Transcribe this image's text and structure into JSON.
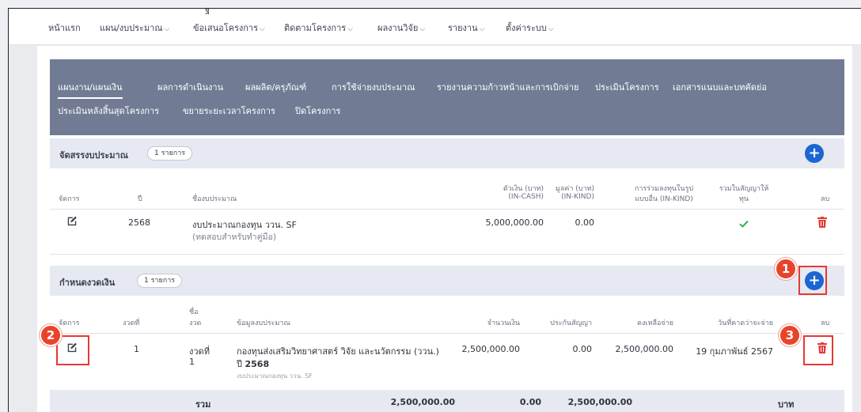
{
  "topnav": {
    "cut_glyph": "ฐ",
    "items": [
      {
        "label": "หน้าแรก",
        "has_chevron": false
      },
      {
        "label": "แผน/งบประมาณ",
        "has_chevron": true
      },
      {
        "label": "ข้อเสนอโครงการ",
        "has_chevron": true
      },
      {
        "label": "ติดตามโครงการ",
        "has_chevron": true
      },
      {
        "label": "ผลงานวิจัย",
        "has_chevron": true
      },
      {
        "label": "รายงาน",
        "has_chevron": true
      },
      {
        "label": "ตั้งค่าระบบ",
        "has_chevron": true
      }
    ],
    "chevron": "⌵"
  },
  "tabs": [
    "แผนงาน/แผนเงิน",
    "ผลการดำเนินงาน",
    "ผลผลิต/ครุภัณฑ์",
    "การใช้จ่ายงบประมาณ",
    "รายงานความก้าวหน้าและการเบิกจ่าย",
    "ประเมินโครงการ",
    "เอกสารแนบและบทคัดย่อ",
    "ประเมินหลังสิ้นสุดโครงการ",
    "ขยายระยะเวลาโครงการ",
    "ปิดโครงการ"
  ],
  "budget": {
    "title": "จัดสรรงบประมาณ",
    "count": "1 รายการ",
    "headers": {
      "manage": "จัดการ",
      "year": "ปี",
      "name": "ชื่องบประมาณ",
      "cash_1": "ตัวเงิน (บาท)",
      "cash_2": "(IN-CASH)",
      "kind_1": "มูลค่า (บาท)",
      "kind_2": "(IN-KIND)",
      "other_1": "การร่วมลงทุนในรูป",
      "other_2": "แบบอื่น (IN-KIND)",
      "contract_1": "รวมในสัญญาให้",
      "contract_2": "ทุน",
      "delete": "ลบ"
    },
    "row": {
      "year": "2568",
      "name": "งบประมาณกองทุน ววน. SF",
      "note": "(ทดสอบสำหรับทำคู่มือ)",
      "cash": "5,000,000.00",
      "kind": "0.00",
      "in_contract": true
    }
  },
  "installments": {
    "title": "กำหนดงวดเงิน",
    "count": "1 รายการ",
    "headers": {
      "manage": "จัดการ",
      "no": "งวดที่",
      "inst_name_1": "ชื่อ",
      "inst_name_2": "งวด",
      "budget_info": "ข้อมูลงบประมาณ",
      "amount": "จำนวนเงิน",
      "guarantee": "ประกันสัญญา",
      "remaining": "คงเหลือจ่าย",
      "due_date": "วันที่คาดว่าจะจ่าย",
      "delete": "ลบ"
    },
    "row": {
      "no": "1",
      "name_1": "งวดที่",
      "name_2": "1",
      "fund": "กองทุนส่งเสริมวิทยาศาสตร์ วิจัย และนวัตกรรม (ววน.)",
      "year_prefix": "ปี ",
      "year": "2568",
      "budget_ref": "งบประมาณกองทุน ววน. SF",
      "amount": "2,500,000.00",
      "guarantee": "0.00",
      "remaining": "2,500,000.00",
      "due_date": "19 กุมภาพันธ์ 2567"
    },
    "total": {
      "label": "รวม",
      "amount": "2,500,000.00",
      "guarantee": "0.00",
      "remaining": "2,500,000.00",
      "unit": "บาท"
    }
  },
  "callouts": [
    "1",
    "2",
    "3"
  ],
  "icons": {
    "plus": "+",
    "edit": "edit-icon",
    "delete": "trash-icon",
    "check": "check-icon"
  },
  "colors": {
    "tabbar": "#717c94",
    "accent": "#1b66d2",
    "danger": "#e53935",
    "success": "#2eae55",
    "callout": "#e8442c"
  }
}
